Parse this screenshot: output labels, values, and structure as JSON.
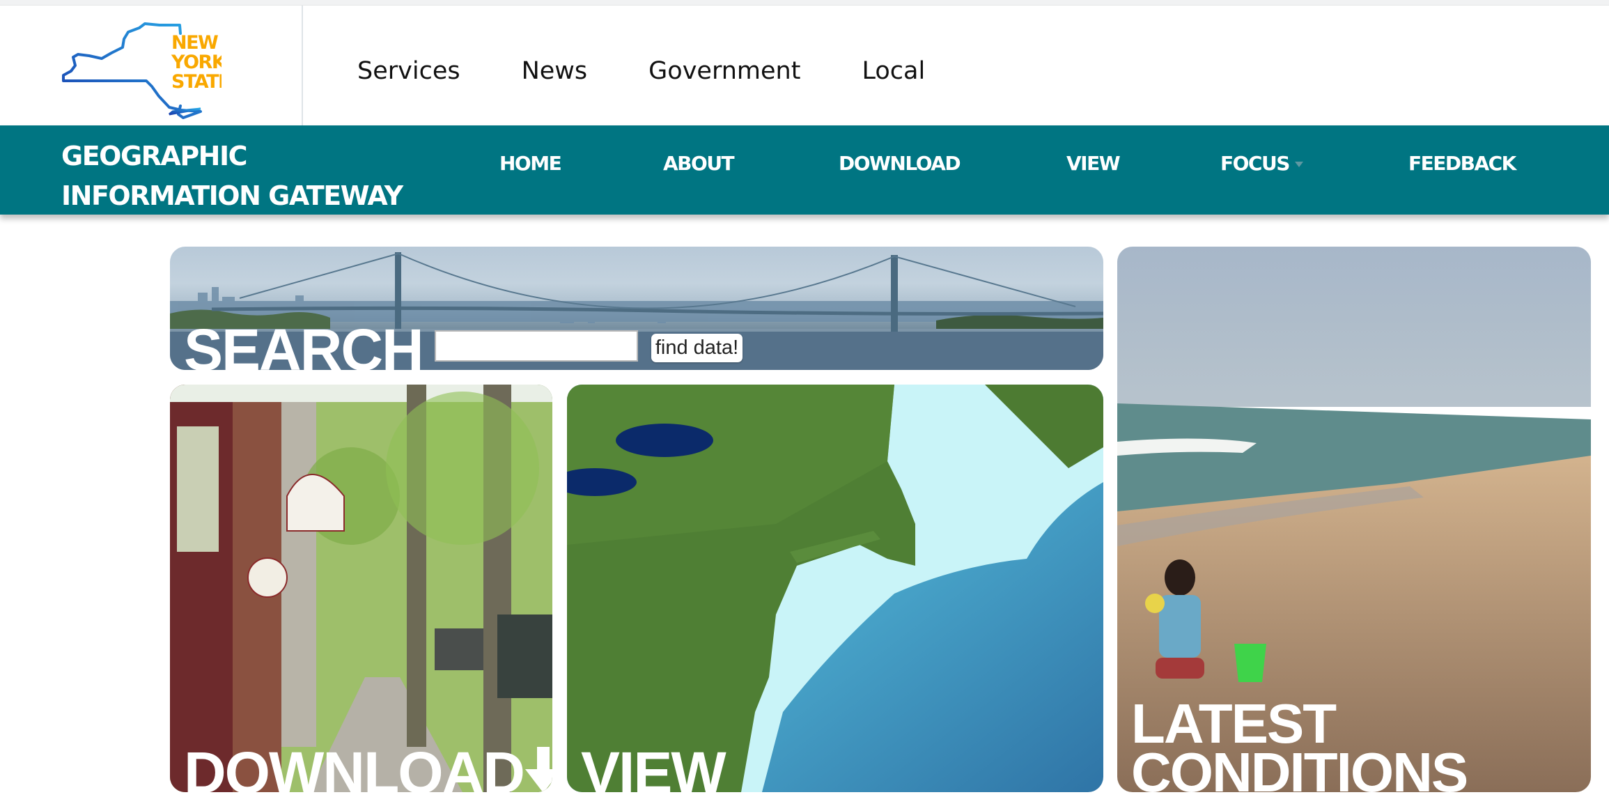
{
  "header": {
    "logo_text": [
      "NEW",
      "YORK",
      "STATE"
    ],
    "logo_colors": {
      "outline": "#1f5fbf",
      "text": "#f9a800"
    },
    "top_nav": [
      "Services",
      "News",
      "Government",
      "Local"
    ]
  },
  "site_band": {
    "title_line1": "GEOGRAPHIC",
    "title_line2": "INFORMATION GATEWAY",
    "bg_color": "#007582",
    "nav": [
      {
        "label": "HOME"
      },
      {
        "label": "ABOUT"
      },
      {
        "label": "DOWNLOAD"
      },
      {
        "label": "VIEW"
      },
      {
        "label": "FOCUS",
        "has_dropdown": true
      },
      {
        "label": "FEEDBACK"
      }
    ]
  },
  "tiles": {
    "search": {
      "label": "SEARCH",
      "input_value": "",
      "input_placeholder": "",
      "button_label": "find data!",
      "image": "bridge-skyline-photo"
    },
    "download": {
      "label": "DOWNLOAD",
      "icon": "down-arrow-icon",
      "image": "street-scene-photo"
    },
    "view": {
      "label": "VIEW",
      "image": "northeast-relief-map"
    },
    "conditions": {
      "label_line1": "LATEST",
      "label_line2": "CONDITIONS",
      "image": "beach-photo"
    }
  }
}
